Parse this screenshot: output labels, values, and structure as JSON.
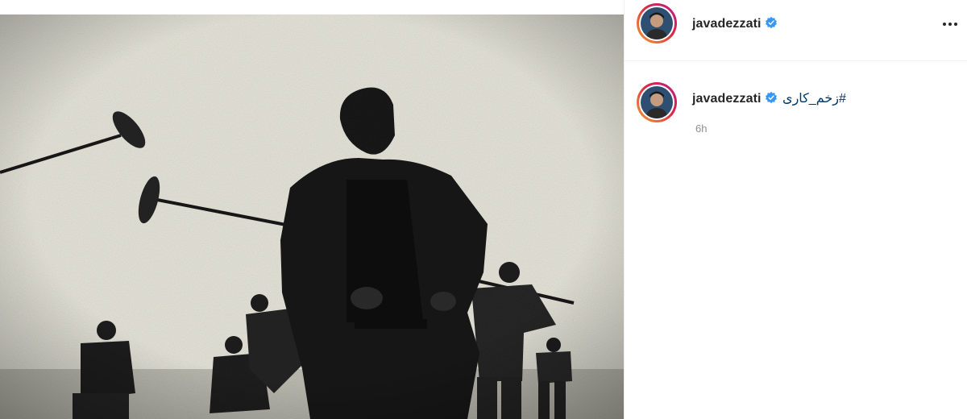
{
  "post": {
    "username": "javadezzati",
    "verified": true,
    "caption_hashtag": "#زخم_کاری",
    "timestamp": "6h",
    "image_alt": "Black and white film set photo: man in a dark coat looking down, boom microphones and crew in the background"
  },
  "icons": {
    "verified": "verified-badge-icon",
    "more": "more-options-icon"
  },
  "colors": {
    "link": "#00376b",
    "verified": "#3897f0",
    "muted": "#8e8e8e"
  }
}
